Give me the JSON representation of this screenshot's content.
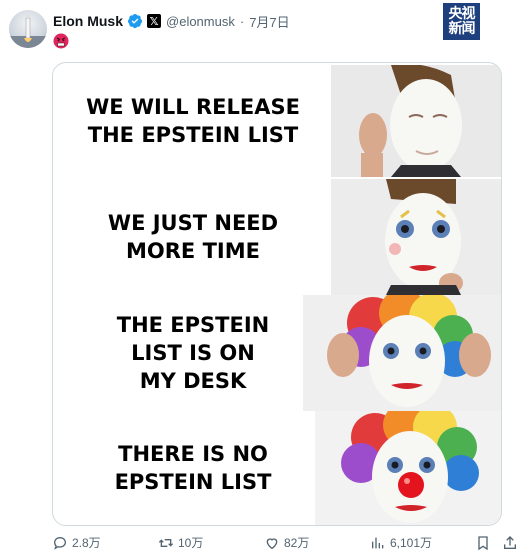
{
  "header": {
    "name": "Elon Musk",
    "handle": "@elonmusk",
    "separator": "·",
    "date": "7月7日",
    "watermark_lines": [
      "央视",
      "新闻"
    ]
  },
  "meme": {
    "panels": [
      {
        "caption": "WE WILL RELEASE\nTHE EPSTEIN LIST",
        "stage": "white makeup"
      },
      {
        "caption": "WE JUST NEED\nMORE TIME",
        "stage": "eyes and lips"
      },
      {
        "caption": "THE EPSTEIN\nLIST IS ON\nMY DESK",
        "stage": "rainbow wig"
      },
      {
        "caption": "THERE IS NO\nEPSTEIN LIST",
        "stage": "red nose"
      }
    ]
  },
  "actions": {
    "replies": "2.8万",
    "reposts": "10万",
    "likes": "82万",
    "views": "6,101万"
  },
  "icons": [
    "avatar-rocket-icon",
    "verified-badge-icon",
    "x-logo-icon",
    "angry-face-icon",
    "reply-icon",
    "repost-icon",
    "like-icon",
    "views-icon",
    "bookmark-icon",
    "share-icon"
  ],
  "colors": {
    "verified": "#1d9bf0",
    "watermark": "#1d3f7e",
    "muted": "#536471",
    "border": "#cfd9de"
  }
}
